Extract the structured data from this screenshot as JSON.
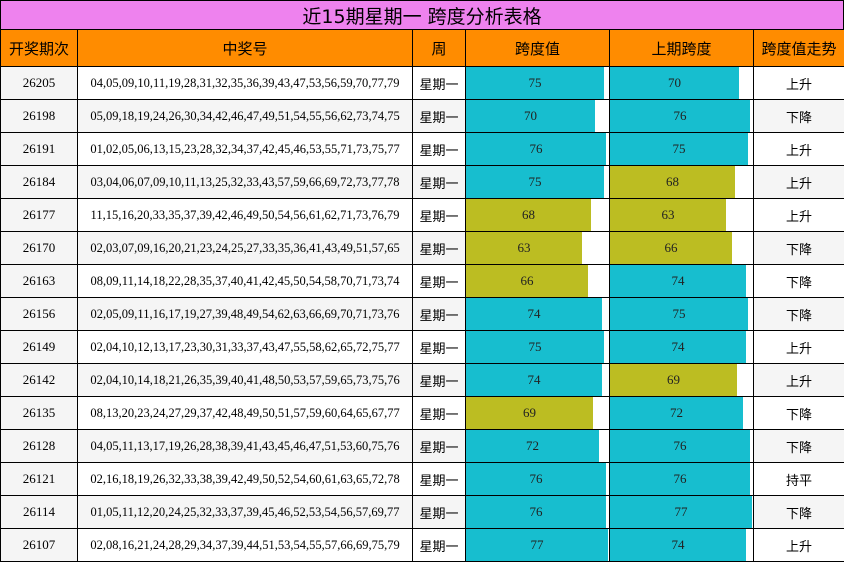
{
  "title": "近15期星期一 跨度分析表格",
  "colors": {
    "title_bg": "#ee82ee",
    "header_bg": "#ff8c00",
    "bar_high": "#17becf",
    "bar_low": "#bcbd22"
  },
  "headers": [
    "开奖期次",
    "中奖号",
    "周",
    "跨度值",
    "上期跨度",
    "跨度值走势"
  ],
  "bar_scale_max": 77,
  "bar_color_threshold": 70,
  "rows": [
    {
      "period": "26205",
      "numbers": "04,05,09,10,11,19,28,31,32,35,36,39,43,47,53,56,59,70,77,79",
      "week": "星期一",
      "span": 75,
      "prev_span": 70,
      "trend": "上升"
    },
    {
      "period": "26198",
      "numbers": "05,09,18,19,24,26,30,34,42,46,47,49,51,54,55,56,62,73,74,75",
      "week": "星期一",
      "span": 70,
      "prev_span": 76,
      "trend": "下降"
    },
    {
      "period": "26191",
      "numbers": "01,02,05,06,13,15,23,28,32,34,37,42,45,46,53,55,71,73,75,77",
      "week": "星期一",
      "span": 76,
      "prev_span": 75,
      "trend": "上升"
    },
    {
      "period": "26184",
      "numbers": "03,04,06,07,09,10,11,13,25,32,33,43,57,59,66,69,72,73,77,78",
      "week": "星期一",
      "span": 75,
      "prev_span": 68,
      "trend": "上升"
    },
    {
      "period": "26177",
      "numbers": "11,15,16,20,33,35,37,39,42,46,49,50,54,56,61,62,71,73,76,79",
      "week": "星期一",
      "span": 68,
      "prev_span": 63,
      "trend": "上升"
    },
    {
      "period": "26170",
      "numbers": "02,03,07,09,16,20,21,23,24,25,27,33,35,36,41,43,49,51,57,65",
      "week": "星期一",
      "span": 63,
      "prev_span": 66,
      "trend": "下降"
    },
    {
      "period": "26163",
      "numbers": "08,09,11,14,18,22,28,35,37,40,41,42,45,50,54,58,70,71,73,74",
      "week": "星期一",
      "span": 66,
      "prev_span": 74,
      "trend": "下降"
    },
    {
      "period": "26156",
      "numbers": "02,05,09,11,16,17,19,27,39,48,49,54,62,63,66,69,70,71,73,76",
      "week": "星期一",
      "span": 74,
      "prev_span": 75,
      "trend": "下降"
    },
    {
      "period": "26149",
      "numbers": "02,04,10,12,13,17,23,30,31,33,37,43,47,55,58,62,65,72,75,77",
      "week": "星期一",
      "span": 75,
      "prev_span": 74,
      "trend": "上升"
    },
    {
      "period": "26142",
      "numbers": "02,04,10,14,18,21,26,35,39,40,41,48,50,53,57,59,65,73,75,76",
      "week": "星期一",
      "span": 74,
      "prev_span": 69,
      "trend": "上升"
    },
    {
      "period": "26135",
      "numbers": "08,13,20,23,24,27,29,37,42,48,49,50,51,57,59,60,64,65,67,77",
      "week": "星期一",
      "span": 69,
      "prev_span": 72,
      "trend": "下降"
    },
    {
      "period": "26128",
      "numbers": "04,05,11,13,17,19,26,28,38,39,41,43,45,46,47,51,53,60,75,76",
      "week": "星期一",
      "span": 72,
      "prev_span": 76,
      "trend": "下降"
    },
    {
      "period": "26121",
      "numbers": "02,16,18,19,26,32,33,38,39,42,49,50,52,54,60,61,63,65,72,78",
      "week": "星期一",
      "span": 76,
      "prev_span": 76,
      "trend": "持平"
    },
    {
      "period": "26114",
      "numbers": "01,05,11,12,20,24,25,32,33,37,39,45,46,52,53,54,56,57,69,77",
      "week": "星期一",
      "span": 76,
      "prev_span": 77,
      "trend": "下降"
    },
    {
      "period": "26107",
      "numbers": "02,08,16,21,24,28,29,34,37,39,44,51,53,54,55,57,66,69,75,79",
      "week": "星期一",
      "span": 77,
      "prev_span": 74,
      "trend": "上升"
    }
  ]
}
